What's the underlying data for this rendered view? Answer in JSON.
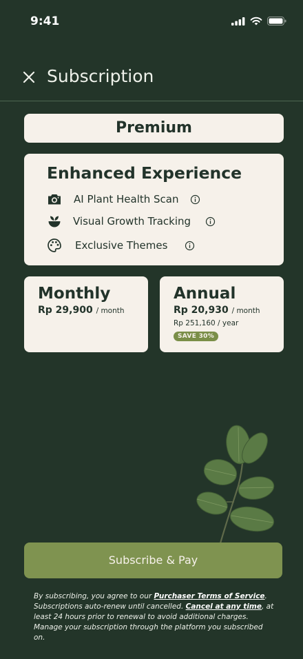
{
  "status": {
    "time": "9:41"
  },
  "header": {
    "title": "Subscription"
  },
  "premium": {
    "title": "Premium"
  },
  "features": {
    "heading": "Enhanced Experience",
    "items": [
      {
        "label": "AI Plant Health Scan",
        "icon": "camera-icon"
      },
      {
        "label": "Visual Growth Tracking",
        "icon": "sprout-icon"
      },
      {
        "label": "Exclusive Themes",
        "icon": "palette-icon"
      }
    ]
  },
  "plans": {
    "monthly": {
      "name": "Monthly",
      "price": "Rp 29,900",
      "unit": "/ month"
    },
    "annual": {
      "name": "Annual",
      "price": "Rp 20,930",
      "unit": "/ month",
      "yearly": "Rp 251,160 / year",
      "badge": "SAVE 30%"
    }
  },
  "cta": {
    "label": "Subscribe & Pay"
  },
  "legal": {
    "p1": "By subscribing, you agree to our ",
    "terms_link": "Purchaser Terms of Service",
    "p2": ". Subscriptions auto-renew until cancelled. ",
    "cancel_link": "Cancel at any time",
    "p3": ", at least 24 hours prior to renewal to avoid additional charges. Manage your subscription through the platform you subscribed on."
  },
  "colors": {
    "background": "#233529",
    "card": "#f6f1ea",
    "text_dark": "#22332a",
    "accent": "#7f9350",
    "badge": "#7a8e48"
  }
}
